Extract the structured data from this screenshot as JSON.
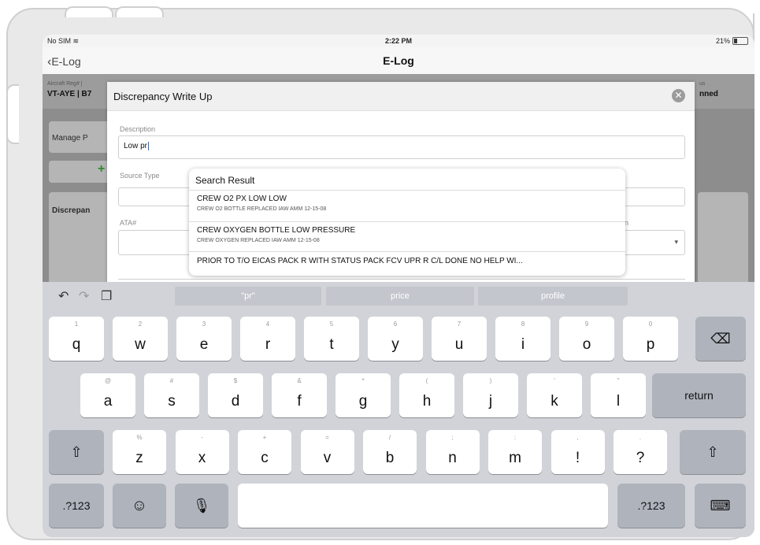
{
  "status_bar": {
    "carrier": "No SIM",
    "time": "2:22 PM",
    "battery": "21%"
  },
  "nav": {
    "back_label": "E-Log",
    "title": "E-Log"
  },
  "background": {
    "aircraft_label": "Aircraft Reg# |",
    "aircraft_value": "VT-AYE | B7",
    "status_label": "us",
    "status_value": "nned",
    "manage_label": "Manage P",
    "discrepancy_label": "Discrepan"
  },
  "modal": {
    "title": "Discrepancy Write Up",
    "description_label": "Description",
    "description_value": "Low pr",
    "source_type_label": "Source Type",
    "ata_label": "ATA#",
    "location_label_fragment": "on"
  },
  "search_result": {
    "heading": "Search Result",
    "items": [
      {
        "main": "CREW O2 PX LOW LOW",
        "sub": "CREW O2 BOTTLE REPLACED IAW AMM 12-15-08"
      },
      {
        "main": "CREW OXYGEN BOTTLE LOW PRESSURE",
        "sub": "CREW OXYGEN REPLACED IAW AMM 12-15-08"
      },
      {
        "main": "PRIOR TO T/O EICAS PACK R WITH STATUS PACK FCV UPR R C/L DONE NO HELP WI...",
        "sub": ""
      }
    ]
  },
  "keyboard": {
    "suggestions": [
      "\"pr\"",
      "price",
      "profile"
    ],
    "row1": [
      {
        "k": "q",
        "s": "1"
      },
      {
        "k": "w",
        "s": "2"
      },
      {
        "k": "e",
        "s": "3"
      },
      {
        "k": "r",
        "s": "4"
      },
      {
        "k": "t",
        "s": "5"
      },
      {
        "k": "y",
        "s": "6"
      },
      {
        "k": "u",
        "s": "7"
      },
      {
        "k": "i",
        "s": "8"
      },
      {
        "k": "o",
        "s": "9"
      },
      {
        "k": "p",
        "s": "0"
      }
    ],
    "row2": [
      {
        "k": "a",
        "s": "@"
      },
      {
        "k": "s",
        "s": "#"
      },
      {
        "k": "d",
        "s": "$"
      },
      {
        "k": "f",
        "s": "&"
      },
      {
        "k": "g",
        "s": "*"
      },
      {
        "k": "h",
        "s": "("
      },
      {
        "k": "j",
        "s": ")"
      },
      {
        "k": "k",
        "s": "'"
      },
      {
        "k": "l",
        "s": "\""
      }
    ],
    "row3": [
      {
        "k": "z",
        "s": "%"
      },
      {
        "k": "x",
        "s": "-"
      },
      {
        "k": "c",
        "s": "+"
      },
      {
        "k": "v",
        "s": "="
      },
      {
        "k": "b",
        "s": "/"
      },
      {
        "k": "n",
        "s": ";"
      },
      {
        "k": "m",
        "s": ":"
      },
      {
        "k": "!",
        "s": ","
      },
      {
        "k": "?",
        "s": "."
      }
    ],
    "return_label": "return",
    "numbers_label": ".?123"
  }
}
